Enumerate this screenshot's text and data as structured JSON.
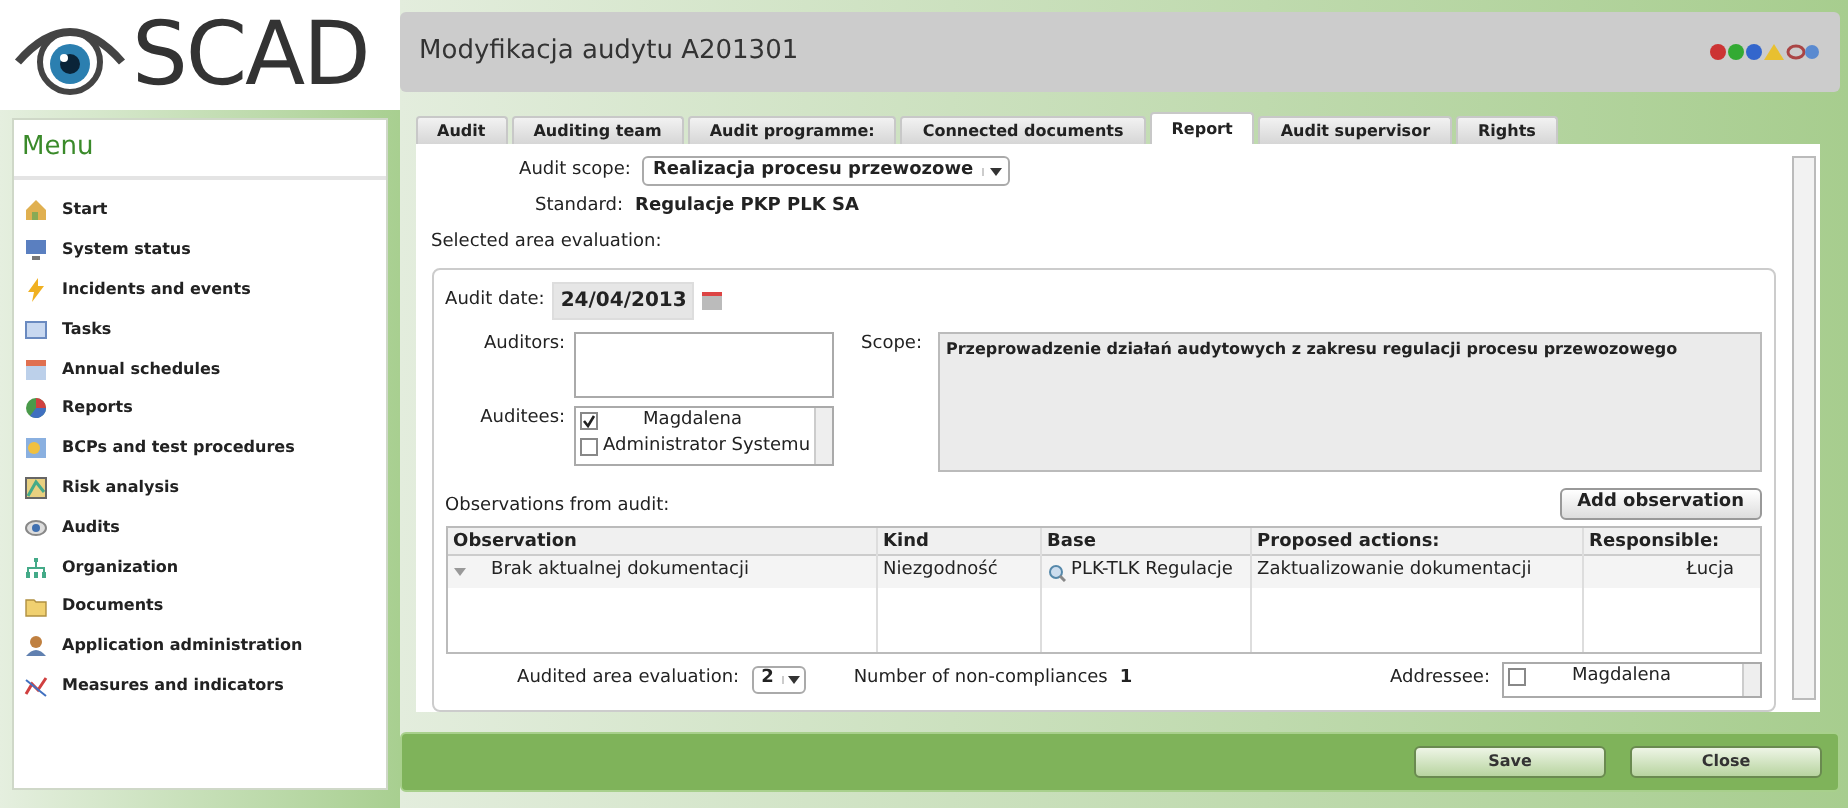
{
  "logo": {
    "text": "SCAD"
  },
  "window": {
    "title": "Modyfikacja audytu A201301"
  },
  "menu": {
    "title": "Menu",
    "items": [
      {
        "label": "Start"
      },
      {
        "label": "System status"
      },
      {
        "label": "Incidents and events"
      },
      {
        "label": "Tasks"
      },
      {
        "label": "Annual schedules"
      },
      {
        "label": "Reports"
      },
      {
        "label": "BCPs and test procedures"
      },
      {
        "label": "Risk analysis"
      },
      {
        "label": "Audits"
      },
      {
        "label": "Organization"
      },
      {
        "label": "Documents"
      },
      {
        "label": "Application administration"
      },
      {
        "label": "Measures and indicators"
      }
    ]
  },
  "tabs": [
    {
      "label": "Audit",
      "selected": false
    },
    {
      "label": "Auditing team",
      "selected": false
    },
    {
      "label": "Audit programme:",
      "selected": false
    },
    {
      "label": "Connected documents",
      "selected": false
    },
    {
      "label": "Report",
      "selected": true
    },
    {
      "label": "Audit supervisor",
      "selected": false
    },
    {
      "label": "Rights",
      "selected": false
    }
  ],
  "form": {
    "audit_scope_label": "Audit scope:",
    "audit_scope_value": "Realizacja procesu przewozowe",
    "standard_label": "Standard:",
    "standard_value": "Regulacje PKP PLK SA",
    "section_label": "Selected area evaluation:",
    "audit_date_label": "Audit date:",
    "audit_date": "24/04/2013",
    "auditors_label": "Auditors:",
    "auditees_label": "Auditees:",
    "auditees": [
      {
        "name": "Magdalena",
        "checked": true
      },
      {
        "name": "Administrator Systemu",
        "checked": false
      }
    ],
    "scope_label": "Scope:",
    "scope_value": "Przeprowadzenie działań audytowych z zakresu regulacji procesu przewozowego",
    "observations_label": "Observations from audit:",
    "add_button": "Add observation"
  },
  "table": {
    "columns": [
      "Observation",
      "Kind",
      "Base",
      "Proposed actions:",
      "Responsible:"
    ],
    "rows": [
      {
        "cells": [
          "Brak aktualnej dokumentacji",
          "Niezgodność",
          "PLK-TLK Regulacje",
          "Zaktualizowanie dokumentacji",
          "Łucja"
        ]
      }
    ]
  },
  "footer": {
    "evaluation_label": "Audited area evaluation:",
    "evaluation_value": "2",
    "noncompliance_label": "Number of non-compliances",
    "noncompliance_value": "1",
    "addressee_label": "Addressee:",
    "addressees": [
      {
        "name": "Magdalena",
        "checked": false
      }
    ]
  },
  "buttons": [
    "Save",
    "Close"
  ]
}
